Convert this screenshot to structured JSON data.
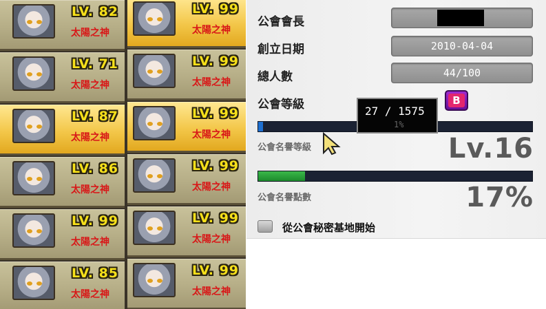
{
  "members": [
    {
      "level": "LV. 82",
      "title": "太陽之神",
      "highlight": false
    },
    {
      "level": "LV. 71",
      "title": "太陽之神",
      "highlight": false
    },
    {
      "level": "LV. 87",
      "title": "太陽之神",
      "highlight": true
    },
    {
      "level": "LV. 86",
      "title": "太陽之神",
      "highlight": false
    },
    {
      "level": "LV. 99",
      "title": "太陽之神",
      "highlight": false
    },
    {
      "level": "LV. 85",
      "title": "太陽之神",
      "highlight": false
    },
    {
      "level": "LV. 99",
      "title": "太陽之神",
      "highlight": true
    },
    {
      "level": "LV. 99",
      "title": "太陽之神",
      "highlight": false
    },
    {
      "level": "LV. 99",
      "title": "太陽之神",
      "highlight": true
    },
    {
      "level": "LV. 99",
      "title": "太陽之神",
      "highlight": false
    },
    {
      "level": "LV. 99",
      "title": "太陽之神",
      "highlight": false
    },
    {
      "level": "LV. 99",
      "title": "太陽之神",
      "highlight": false
    }
  ],
  "guild": {
    "leader_label": "公會會長",
    "founded_label": "創立日期",
    "founded_value": "2010-04-04",
    "members_label": "總人數",
    "members_value": "44/100",
    "grade_label": "公會等級",
    "grade_badge": "B",
    "exp_tooltip": "27 / 1575",
    "exp_tooltip_shadow": "1%",
    "exp_progress": 0.017,
    "rep_level_label": "公會名譽等級",
    "rep_level_value": "Lv.16",
    "rep_points_label": "公會名譽點數",
    "rep_points_value": "17%",
    "rep_progress": 0.17,
    "start_option_label": "從公會秘密基地開始"
  },
  "colors": {
    "card_highlight": "#f3c74a",
    "level_text": "#f6e01a",
    "title_text": "#d81818",
    "grade_badge": "#e3266e",
    "rep_bar": "#2aa03a"
  }
}
